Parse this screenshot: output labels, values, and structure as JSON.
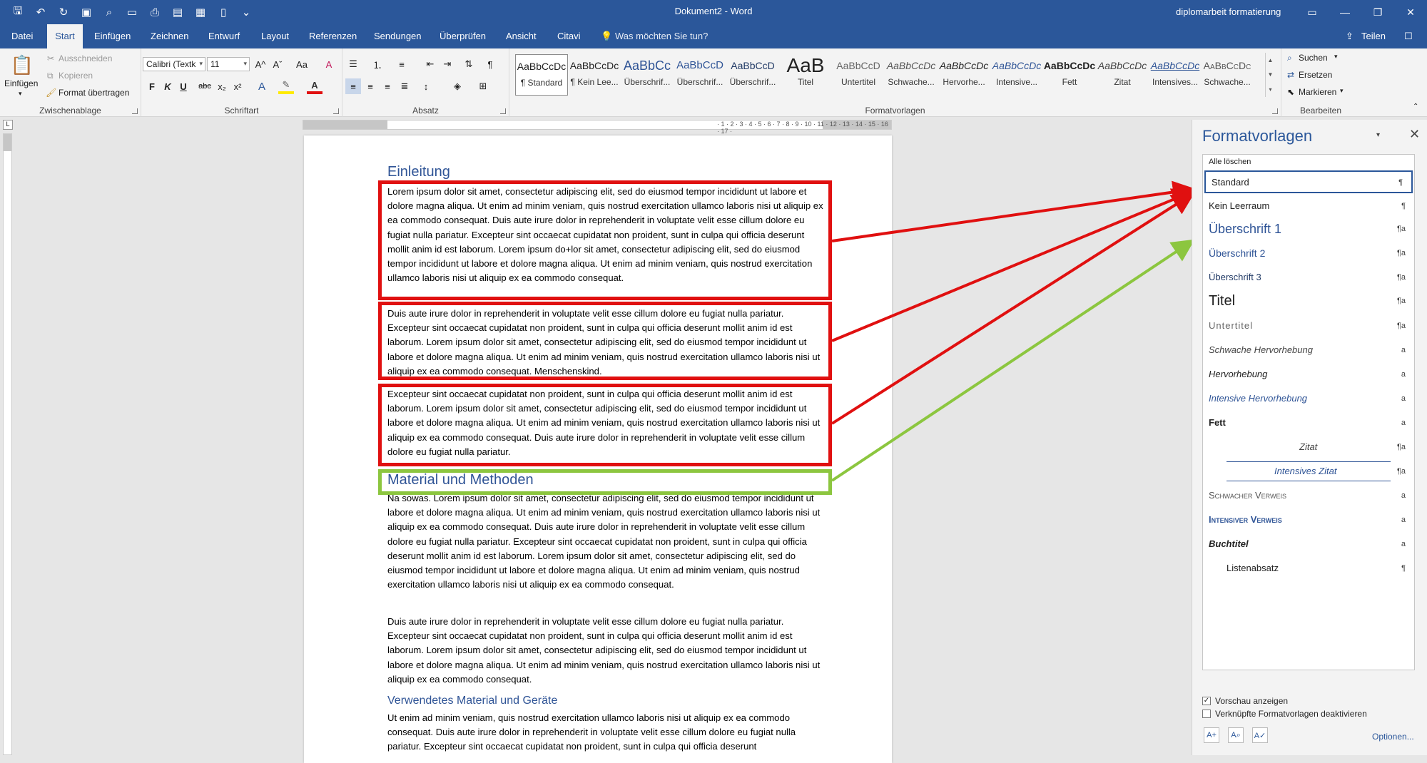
{
  "titlebar": {
    "doc_title": "Dokument2  -  Word",
    "user": "diplomarbeit formatierung",
    "quick_access_icons": [
      "save-icon",
      "undo-icon",
      "redo-icon",
      "save-as-icon",
      "print-preview-icon",
      "open-icon",
      "print-icon",
      "view-icon",
      "table-icon",
      "new-doc-icon",
      "customize-icon"
    ],
    "window_buttons": [
      "ribbon-display-icon",
      "minimize-icon",
      "restore-icon",
      "close-icon"
    ]
  },
  "tabs": {
    "items": [
      "Datei",
      "Start",
      "Einfügen",
      "Zeichnen",
      "Entwurf",
      "Layout",
      "Referenzen",
      "Sendungen",
      "Überprüfen",
      "Ansicht",
      "Citavi"
    ],
    "active": "Start",
    "tell_me": "Was möchten Sie tun?",
    "share": "Teilen"
  },
  "ribbon": {
    "clipboard": {
      "label": "Zwischenablage",
      "paste": "Einfügen",
      "cut": "Ausschneiden",
      "copy": "Kopieren",
      "format_painter": "Format übertragen"
    },
    "font": {
      "label": "Schriftart",
      "font_name": "Calibri (Textk",
      "font_size": "11",
      "bold": "F",
      "italic": "K",
      "underline": "U",
      "strike": "abc",
      "subscript": "x₂",
      "superscript": "x²",
      "grow": "A^",
      "shrink": "Aˇ",
      "case": "Aa",
      "clear": "A"
    },
    "paragraph": {
      "label": "Absatz"
    },
    "styles": {
      "label": "Formatvorlagen",
      "tiles": [
        {
          "preview": "AaBbCcDc",
          "name": "¶ Standard"
        },
        {
          "preview": "AaBbCcDc",
          "name": "¶ Kein Lee..."
        },
        {
          "preview": "AaBbCc",
          "name": "Überschrif..."
        },
        {
          "preview": "AaBbCcD",
          "name": "Überschrif..."
        },
        {
          "preview": "AaBbCcD",
          "name": "Überschrif..."
        },
        {
          "preview": "AaB",
          "name": "Titel"
        },
        {
          "preview": "AaBbCcD",
          "name": "Untertitel"
        },
        {
          "preview": "AaBbCcDc",
          "name": "Schwache..."
        },
        {
          "preview": "AaBbCcDc",
          "name": "Hervorhe..."
        },
        {
          "preview": "AaBbCcDc",
          "name": "Intensive..."
        },
        {
          "preview": "AaBbCcDc",
          "name": "Fett"
        },
        {
          "preview": "AaBbCcDc",
          "name": "Zitat"
        },
        {
          "preview": "AaBbCcDc",
          "name": "Intensives..."
        },
        {
          "preview": "AaBbCcDc",
          "name": "Schwache..."
        }
      ]
    },
    "editing": {
      "label": "Bearbeiten",
      "find": "Suchen",
      "replace": "Ersetzen",
      "select": "Markieren"
    }
  },
  "document": {
    "heading1": "Einleitung",
    "para1": "Lorem ipsum dolor sit amet, consectetur adipiscing elit, sed do eiusmod tempor incididunt ut labore et dolore magna aliqua. Ut enim ad minim veniam, quis nostrud exercitation ullamco laboris nisi ut aliquip ex ea commodo consequat. Duis aute irure dolor in reprehenderit in voluptate velit esse cillum dolore eu fugiat nulla pariatur. Excepteur sint occaecat cupidatat non proident, sunt in culpa qui officia deserunt mollit anim id est laborum. Lorem ipsum do+lor sit amet, consectetur adipiscing elit, sed do eiusmod tempor incididunt ut labore et dolore magna aliqua. Ut enim ad minim veniam, quis nostrud exercitation ullamco laboris nisi ut aliquip ex ea commodo consequat.",
    "para2": "Duis aute irure dolor in reprehenderit in voluptate velit esse cillum dolore eu fugiat nulla pariatur. Excepteur sint occaecat cupidatat non proident, sunt in culpa qui officia deserunt mollit anim id est laborum. Lorem ipsum dolor sit amet, consectetur adipiscing elit, sed do eiusmod tempor incididunt ut labore et dolore magna aliqua. Ut enim ad minim veniam, quis nostrud exercitation ullamco laboris nisi ut aliquip ex ea commodo consequat. Menschenskind.",
    "para3": "Excepteur sint occaecat cupidatat non proident, sunt in culpa qui officia deserunt mollit anim id est laborum. Lorem ipsum dolor sit amet, consectetur adipiscing elit, sed do eiusmod tempor incididunt ut labore et dolore magna aliqua. Ut enim ad minim veniam, quis nostrud exercitation ullamco laboris nisi ut aliquip ex ea commodo consequat. Duis aute irure dolor in reprehenderit in voluptate velit esse cillum dolore eu fugiat nulla pariatur.",
    "heading2": "Material und Methoden",
    "para4": "Na sowas. Lorem ipsum dolor sit amet, consectetur adipiscing elit, sed do eiusmod tempor incididunt ut labore et dolore magna aliqua. Ut enim ad minim veniam, quis nostrud exercitation ullamco laboris nisi ut aliquip ex ea commodo consequat. Duis aute irure dolor in reprehenderit in voluptate velit esse cillum dolore eu fugiat nulla pariatur. Excepteur sint occaecat cupidatat non proident, sunt in culpa qui officia deserunt mollit anim id est laborum. Lorem ipsum dolor sit amet, consectetur adipiscing elit, sed do eiusmod tempor incididunt ut labore et dolore magna aliqua. Ut enim ad minim veniam, quis nostrud exercitation ullamco laboris nisi ut aliquip ex ea commodo consequat.",
    "para5": "Duis aute irure dolor in reprehenderit in voluptate velit esse cillum dolore eu fugiat nulla pariatur. Excepteur sint occaecat cupidatat non proident, sunt in culpa qui officia deserunt mollit anim id est laborum. Lorem ipsum dolor sit amet, consectetur adipiscing elit, sed do eiusmod tempor incididunt ut labore et dolore magna aliqua. Ut enim ad minim veniam, quis nostrud exercitation ullamco laboris nisi ut aliquip ex ea commodo consequat.",
    "heading3": "Verwendetes Material und Geräte",
    "para6": "Ut enim ad minim veniam, quis nostrud exercitation ullamco laboris nisi ut aliquip ex ea commodo consequat. Duis aute irure dolor in reprehenderit in voluptate velit esse cillum dolore eu fugiat nulla pariatur. Excepteur sint occaecat cupidatat non proident, sunt in culpa qui officia deserunt"
  },
  "styles_pane": {
    "title": "Formatvorlagen",
    "clear_all": "Alle löschen",
    "items": [
      {
        "label": "Standard",
        "mark": "¶"
      },
      {
        "label": "Kein Leerraum",
        "mark": "¶"
      },
      {
        "label": "Überschrift 1",
        "mark": "¶a"
      },
      {
        "label": "Überschrift 2",
        "mark": "¶a"
      },
      {
        "label": "Überschrift 3",
        "mark": "¶a"
      },
      {
        "label": "Titel",
        "mark": "¶a"
      },
      {
        "label": "Untertitel",
        "mark": "¶a"
      },
      {
        "label": "Schwache Hervorhebung",
        "mark": "a"
      },
      {
        "label": "Hervorhebung",
        "mark": "a"
      },
      {
        "label": "Intensive Hervorhebung",
        "mark": "a"
      },
      {
        "label": "Fett",
        "mark": "a"
      },
      {
        "label": "Zitat",
        "mark": "¶a"
      },
      {
        "label": "Intensives Zitat",
        "mark": "¶a"
      },
      {
        "label": "Schwacher Verweis",
        "mark": "a"
      },
      {
        "label": "Intensiver Verweis",
        "mark": "a"
      },
      {
        "label": "Buchtitel",
        "mark": "a"
      },
      {
        "label": "Listenabsatz",
        "mark": "¶"
      }
    ],
    "preview_label": "Vorschau anzeigen",
    "preview_checked": true,
    "linked_label": "Verknüpfte Formatvorlagen deaktivieren",
    "linked_checked": false,
    "options": "Optionen...",
    "bottom_icons": [
      "new-style-icon",
      "style-inspector-icon",
      "manage-styles-icon"
    ]
  },
  "colors": {
    "accent": "#2b579a",
    "heading": "#2f5496",
    "highlight_red": "#e01010",
    "highlight_green": "#8cc63f"
  }
}
